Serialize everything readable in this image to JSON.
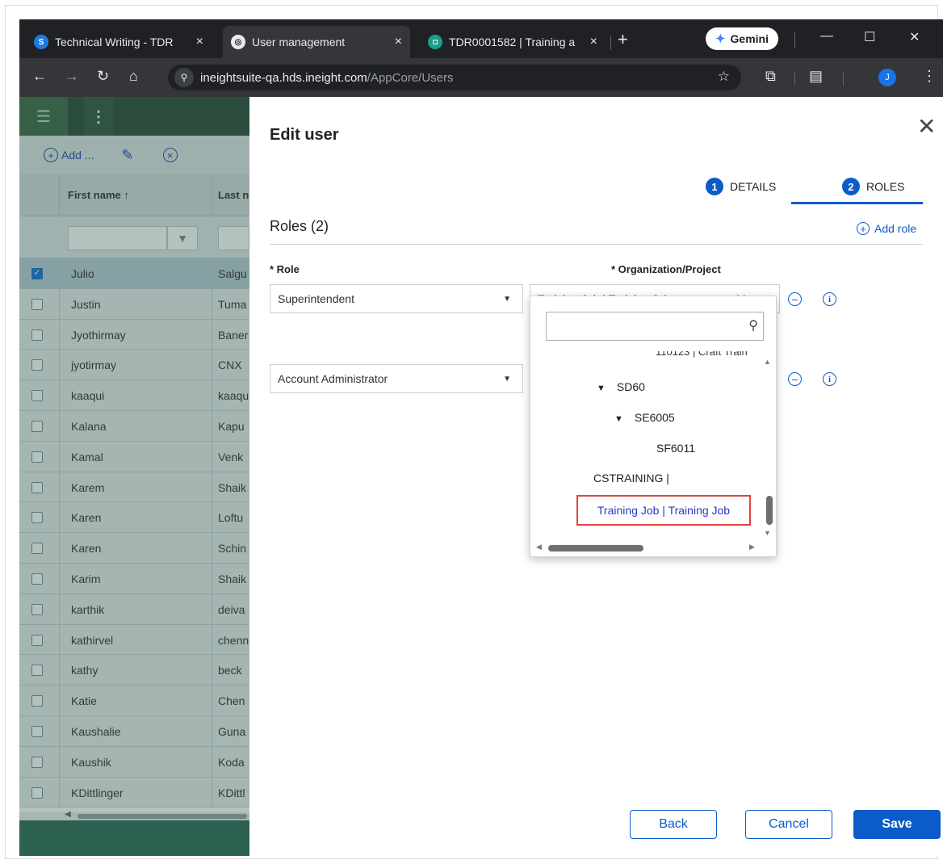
{
  "browser": {
    "tabs": [
      {
        "title": "Technical Writing - TDR",
        "close": "×"
      },
      {
        "title": "User management",
        "close": "×"
      },
      {
        "title": "TDR0001582 | Training a",
        "close": "×"
      }
    ],
    "new_tab": "+",
    "gemini_label": "Gemini",
    "url_host": "ineightsuite-qa.hds.ineight.com",
    "url_path": "/AppCore/Users",
    "profile_initial": "J"
  },
  "grid": {
    "add_label": "Add ...",
    "col_first_name": "First name",
    "col_last_name": "Last n",
    "rows": [
      {
        "first": "Julio",
        "last": "Salgu",
        "selected": true
      },
      {
        "first": "Justin",
        "last": "Tuma"
      },
      {
        "first": "Jyothirmay",
        "last": "Baner"
      },
      {
        "first": "jyotirmay",
        "last": "CNX"
      },
      {
        "first": "kaaqui",
        "last": "kaaqu"
      },
      {
        "first": "Kalana",
        "last": "Kapu"
      },
      {
        "first": "Kamal",
        "last": "Venk"
      },
      {
        "first": "Karem",
        "last": "Shaik"
      },
      {
        "first": "Karen",
        "last": "Loftu"
      },
      {
        "first": "Karen",
        "last": "Schin"
      },
      {
        "first": "Karim",
        "last": "Shaik"
      },
      {
        "first": "karthik",
        "last": "deiva"
      },
      {
        "first": "kathirvel",
        "last": "chenn"
      },
      {
        "first": "kathy",
        "last": "beck"
      },
      {
        "first": "Katie",
        "last": "Chen"
      },
      {
        "first": "Kaushalie",
        "last": "Guna"
      },
      {
        "first": "Kaushik",
        "last": "Koda"
      },
      {
        "first": "KDittlinger",
        "last": "KDittl"
      }
    ]
  },
  "panel": {
    "title": "Edit user",
    "steps": [
      {
        "num": "1",
        "label": "DETAILS"
      },
      {
        "num": "2",
        "label": "ROLES"
      }
    ],
    "roles_heading": "Roles (2)",
    "add_role": "Add role",
    "role_label": "* Role",
    "org_label": "* Organization/Project",
    "roles": [
      {
        "role": "Superintendent",
        "org": "Training Job | Training Job"
      },
      {
        "role": "Account Administrator",
        "org": ""
      }
    ],
    "buttons": {
      "back": "Back",
      "cancel": "Cancel",
      "save": "Save"
    }
  },
  "dropdown": {
    "search_value": "",
    "clipped_item": "110123 | Craft Train",
    "items": [
      {
        "label": "SD60",
        "level": 1,
        "expanded": true
      },
      {
        "label": "SE6005",
        "level": 2,
        "expanded": true
      },
      {
        "label": "SF6011",
        "level": 3
      },
      {
        "label": "CSTRAINING |",
        "level": 0
      }
    ],
    "highlighted_item": "Training Job | Training Job"
  },
  "colors": {
    "accent": "#0b5cc9",
    "highlight_border": "#e0453e",
    "chrome_dark": "#202124",
    "app_green": "#2f6b5a"
  }
}
